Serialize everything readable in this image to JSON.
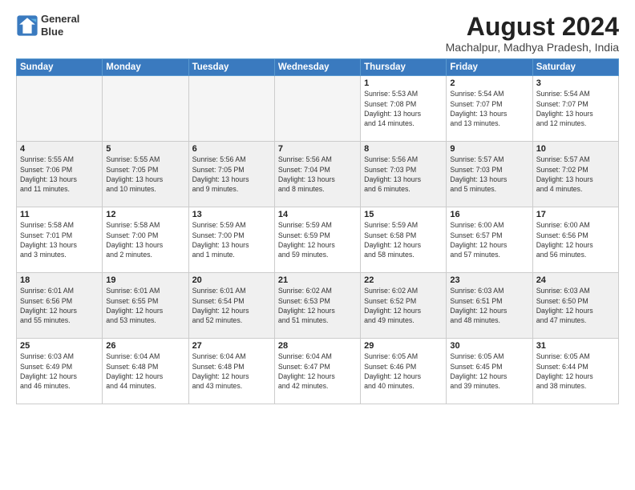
{
  "header": {
    "logo_line1": "General",
    "logo_line2": "Blue",
    "month_year": "August 2024",
    "location": "Machalpur, Madhya Pradesh, India"
  },
  "weekdays": [
    "Sunday",
    "Monday",
    "Tuesday",
    "Wednesday",
    "Thursday",
    "Friday",
    "Saturday"
  ],
  "weeks": [
    [
      {
        "day": "",
        "info": ""
      },
      {
        "day": "",
        "info": ""
      },
      {
        "day": "",
        "info": ""
      },
      {
        "day": "",
        "info": ""
      },
      {
        "day": "1",
        "info": "Sunrise: 5:53 AM\nSunset: 7:08 PM\nDaylight: 13 hours\nand 14 minutes."
      },
      {
        "day": "2",
        "info": "Sunrise: 5:54 AM\nSunset: 7:07 PM\nDaylight: 13 hours\nand 13 minutes."
      },
      {
        "day": "3",
        "info": "Sunrise: 5:54 AM\nSunset: 7:07 PM\nDaylight: 13 hours\nand 12 minutes."
      }
    ],
    [
      {
        "day": "4",
        "info": "Sunrise: 5:55 AM\nSunset: 7:06 PM\nDaylight: 13 hours\nand 11 minutes."
      },
      {
        "day": "5",
        "info": "Sunrise: 5:55 AM\nSunset: 7:05 PM\nDaylight: 13 hours\nand 10 minutes."
      },
      {
        "day": "6",
        "info": "Sunrise: 5:56 AM\nSunset: 7:05 PM\nDaylight: 13 hours\nand 9 minutes."
      },
      {
        "day": "7",
        "info": "Sunrise: 5:56 AM\nSunset: 7:04 PM\nDaylight: 13 hours\nand 8 minutes."
      },
      {
        "day": "8",
        "info": "Sunrise: 5:56 AM\nSunset: 7:03 PM\nDaylight: 13 hours\nand 6 minutes."
      },
      {
        "day": "9",
        "info": "Sunrise: 5:57 AM\nSunset: 7:03 PM\nDaylight: 13 hours\nand 5 minutes."
      },
      {
        "day": "10",
        "info": "Sunrise: 5:57 AM\nSunset: 7:02 PM\nDaylight: 13 hours\nand 4 minutes."
      }
    ],
    [
      {
        "day": "11",
        "info": "Sunrise: 5:58 AM\nSunset: 7:01 PM\nDaylight: 13 hours\nand 3 minutes."
      },
      {
        "day": "12",
        "info": "Sunrise: 5:58 AM\nSunset: 7:00 PM\nDaylight: 13 hours\nand 2 minutes."
      },
      {
        "day": "13",
        "info": "Sunrise: 5:59 AM\nSunset: 7:00 PM\nDaylight: 13 hours\nand 1 minute."
      },
      {
        "day": "14",
        "info": "Sunrise: 5:59 AM\nSunset: 6:59 PM\nDaylight: 12 hours\nand 59 minutes."
      },
      {
        "day": "15",
        "info": "Sunrise: 5:59 AM\nSunset: 6:58 PM\nDaylight: 12 hours\nand 58 minutes."
      },
      {
        "day": "16",
        "info": "Sunrise: 6:00 AM\nSunset: 6:57 PM\nDaylight: 12 hours\nand 57 minutes."
      },
      {
        "day": "17",
        "info": "Sunrise: 6:00 AM\nSunset: 6:56 PM\nDaylight: 12 hours\nand 56 minutes."
      }
    ],
    [
      {
        "day": "18",
        "info": "Sunrise: 6:01 AM\nSunset: 6:56 PM\nDaylight: 12 hours\nand 55 minutes."
      },
      {
        "day": "19",
        "info": "Sunrise: 6:01 AM\nSunset: 6:55 PM\nDaylight: 12 hours\nand 53 minutes."
      },
      {
        "day": "20",
        "info": "Sunrise: 6:01 AM\nSunset: 6:54 PM\nDaylight: 12 hours\nand 52 minutes."
      },
      {
        "day": "21",
        "info": "Sunrise: 6:02 AM\nSunset: 6:53 PM\nDaylight: 12 hours\nand 51 minutes."
      },
      {
        "day": "22",
        "info": "Sunrise: 6:02 AM\nSunset: 6:52 PM\nDaylight: 12 hours\nand 49 minutes."
      },
      {
        "day": "23",
        "info": "Sunrise: 6:03 AM\nSunset: 6:51 PM\nDaylight: 12 hours\nand 48 minutes."
      },
      {
        "day": "24",
        "info": "Sunrise: 6:03 AM\nSunset: 6:50 PM\nDaylight: 12 hours\nand 47 minutes."
      }
    ],
    [
      {
        "day": "25",
        "info": "Sunrise: 6:03 AM\nSunset: 6:49 PM\nDaylight: 12 hours\nand 46 minutes."
      },
      {
        "day": "26",
        "info": "Sunrise: 6:04 AM\nSunset: 6:48 PM\nDaylight: 12 hours\nand 44 minutes."
      },
      {
        "day": "27",
        "info": "Sunrise: 6:04 AM\nSunset: 6:48 PM\nDaylight: 12 hours\nand 43 minutes."
      },
      {
        "day": "28",
        "info": "Sunrise: 6:04 AM\nSunset: 6:47 PM\nDaylight: 12 hours\nand 42 minutes."
      },
      {
        "day": "29",
        "info": "Sunrise: 6:05 AM\nSunset: 6:46 PM\nDaylight: 12 hours\nand 40 minutes."
      },
      {
        "day": "30",
        "info": "Sunrise: 6:05 AM\nSunset: 6:45 PM\nDaylight: 12 hours\nand 39 minutes."
      },
      {
        "day": "31",
        "info": "Sunrise: 6:05 AM\nSunset: 6:44 PM\nDaylight: 12 hours\nand 38 minutes."
      }
    ]
  ]
}
